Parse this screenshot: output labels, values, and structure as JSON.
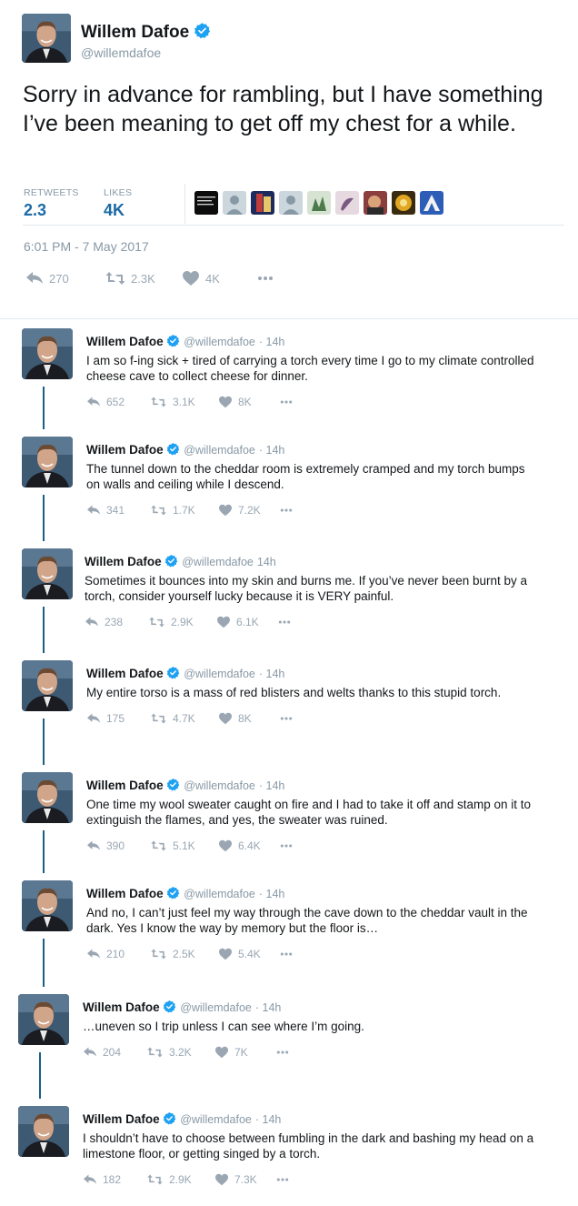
{
  "main": {
    "name": "Willem Dafoe",
    "handle": "@willemdafoe",
    "text": "Sorry in advance for rambling, but I have something I’ve been meaning to get off my chest for a while.",
    "retweets_label": "RETWEETS",
    "retweets": "2.3",
    "likes_label": "LIKES",
    "likes": "4K",
    "timestamp": "6:01 PM - 7 May 2017",
    "actions": {
      "reply": "270",
      "retweet": "2.3K",
      "like": "4K"
    }
  },
  "replies": [
    {
      "name": "Willem Dafoe",
      "handle": "@willemdafoe",
      "time": "· 14h",
      "text": "I am so f-ing sick + tired of carrying a torch every time I go to my climate controlled cheese cave to collect cheese for dinner.",
      "reply": "652",
      "retweet": "3.1K",
      "like": "8K"
    },
    {
      "name": "Willem Dafoe",
      "handle": "@willemdafoe",
      "time": "· 14h",
      "text": "The tunnel down to the cheddar room is extremely cramped and my torch bumps on walls and ceiling while I descend.",
      "reply": "341",
      "retweet": "1.7K",
      "like": "7.2K"
    },
    {
      "name": "Willem Dafoe",
      "handle": "@willemdafoe",
      "time": "14h",
      "text": "Sometimes it bounces into my skin and burns me. If you’ve never been burnt by a torch, consider yourself lucky because it is VERY painful.",
      "reply": "238",
      "retweet": "2.9K",
      "like": "6.1K"
    },
    {
      "name": "Willem Dafoe",
      "handle": "@willemdafoe",
      "time": "· 14h",
      "text": "My entire torso is a mass of red blisters and welts thanks to this stupid torch.",
      "reply": "175",
      "retweet": "4.7K",
      "like": "8K"
    },
    {
      "name": "Willem Dafoe",
      "handle": "@willemdafoe",
      "time": "· 14h",
      "text": "One time my wool sweater caught on fire and I had to take it off and stamp on it to extinguish the flames, and yes, the sweater was ruined.",
      "reply": "390",
      "retweet": "5.1K",
      "like": "6.4K"
    },
    {
      "name": "Willem Dafoe",
      "handle": "@willemdafoe",
      "time": "· 14h",
      "text": "And no, I can’t just feel my way through the cave down to the cheddar vault in the dark. Yes I know the way by memory but the floor is…",
      "reply": "210",
      "retweet": "2.5K",
      "like": "5.4K"
    },
    {
      "name": "Willem Dafoe",
      "handle": "@willemdafoe",
      "time": "· 14h",
      "text": "…uneven so I trip unless I can see where I’m going.",
      "reply": "204",
      "retweet": "3.2K",
      "like": "7K"
    },
    {
      "name": "Willem Dafoe",
      "handle": "@willemdafoe",
      "time": "· 14h",
      "text": "I shouldn’t have to choose between fumbling in the dark and bashing my head on a limestone floor, or getting singed by a torch.",
      "reply": "182",
      "retweet": "2.9K",
      "like": "7.3K"
    }
  ],
  "colors": {
    "accent": "#1da1f2",
    "stat_value": "#1b6aa6",
    "thread_line": "#1b5f84",
    "muted": "#8899a6"
  },
  "icons": [
    "verified-badge-icon",
    "reply-icon",
    "retweet-icon",
    "heart-icon",
    "more-dots-icon"
  ]
}
